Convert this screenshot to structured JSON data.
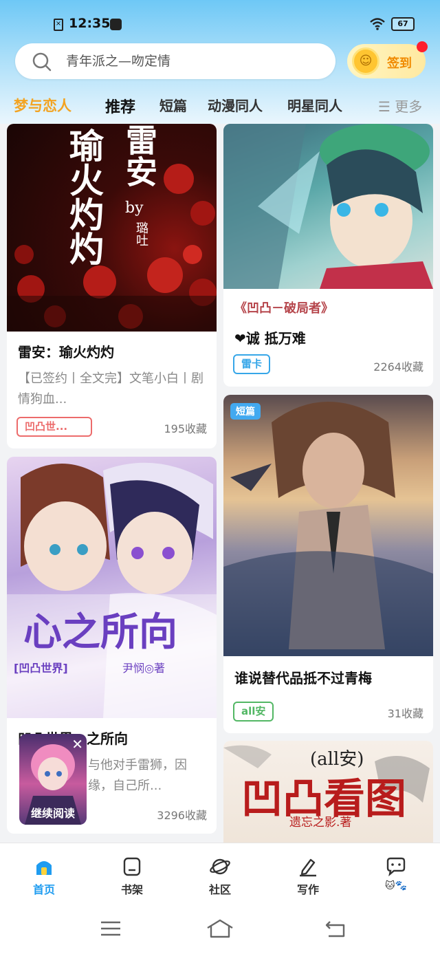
{
  "status": {
    "time": "12:35",
    "battery": "67"
  },
  "search": {
    "placeholder": "青年派之—吻定情"
  },
  "checkin": {
    "label": "签到"
  },
  "tabs": [
    {
      "label": "梦与恋人"
    },
    {
      "label": "推荐"
    },
    {
      "label": "短篇"
    },
    {
      "label": "动漫同人"
    },
    {
      "label": "明星同人"
    }
  ],
  "more_label": "更多",
  "cards": {
    "c1": {
      "cover_lines": [
        "瑜火灼灼",
        "雷安",
        "by",
        "璐吐"
      ],
      "title": "雷安：瑜火灼灼",
      "sub": "【已签约丨全文完】文笔小白丨剧情狗血...",
      "tag": "凹凸世...",
      "fav": "195收藏"
    },
    "c2": {
      "subtitle": "《凹凸－破局者》",
      "title": "诚 抵万难",
      "tag": "雷卡",
      "fav": "2264收藏"
    },
    "c3": {
      "cover_title": "心之所向",
      "cover_brand": "[凹凸世界]",
      "cover_author": "尹悯◎著",
      "title": "凹凸世界：之所向",
      "sub": "与他对手雷狮，因缘，自己所...",
      "fav": "3296收藏"
    },
    "c4": {
      "badge": "短篇",
      "title": "谁说替代品抵不过青梅",
      "tag": "all安",
      "fav": "31收藏"
    },
    "c5": {
      "cover_top": "(all安)",
      "cover_title": "凹凸看图",
      "cover_author": "遗忘之影.著"
    }
  },
  "float": {
    "label": "继续阅读"
  },
  "nav": [
    {
      "label": "首页"
    },
    {
      "label": "书架"
    },
    {
      "label": "社区"
    },
    {
      "label": "写作"
    }
  ],
  "colors": {
    "accent": "#f3a321",
    "nav_active": "#1f9cf0",
    "tag_red": "#ec6b6b",
    "tag_green": "#52b764",
    "tag_blue": "#36a6e8"
  }
}
